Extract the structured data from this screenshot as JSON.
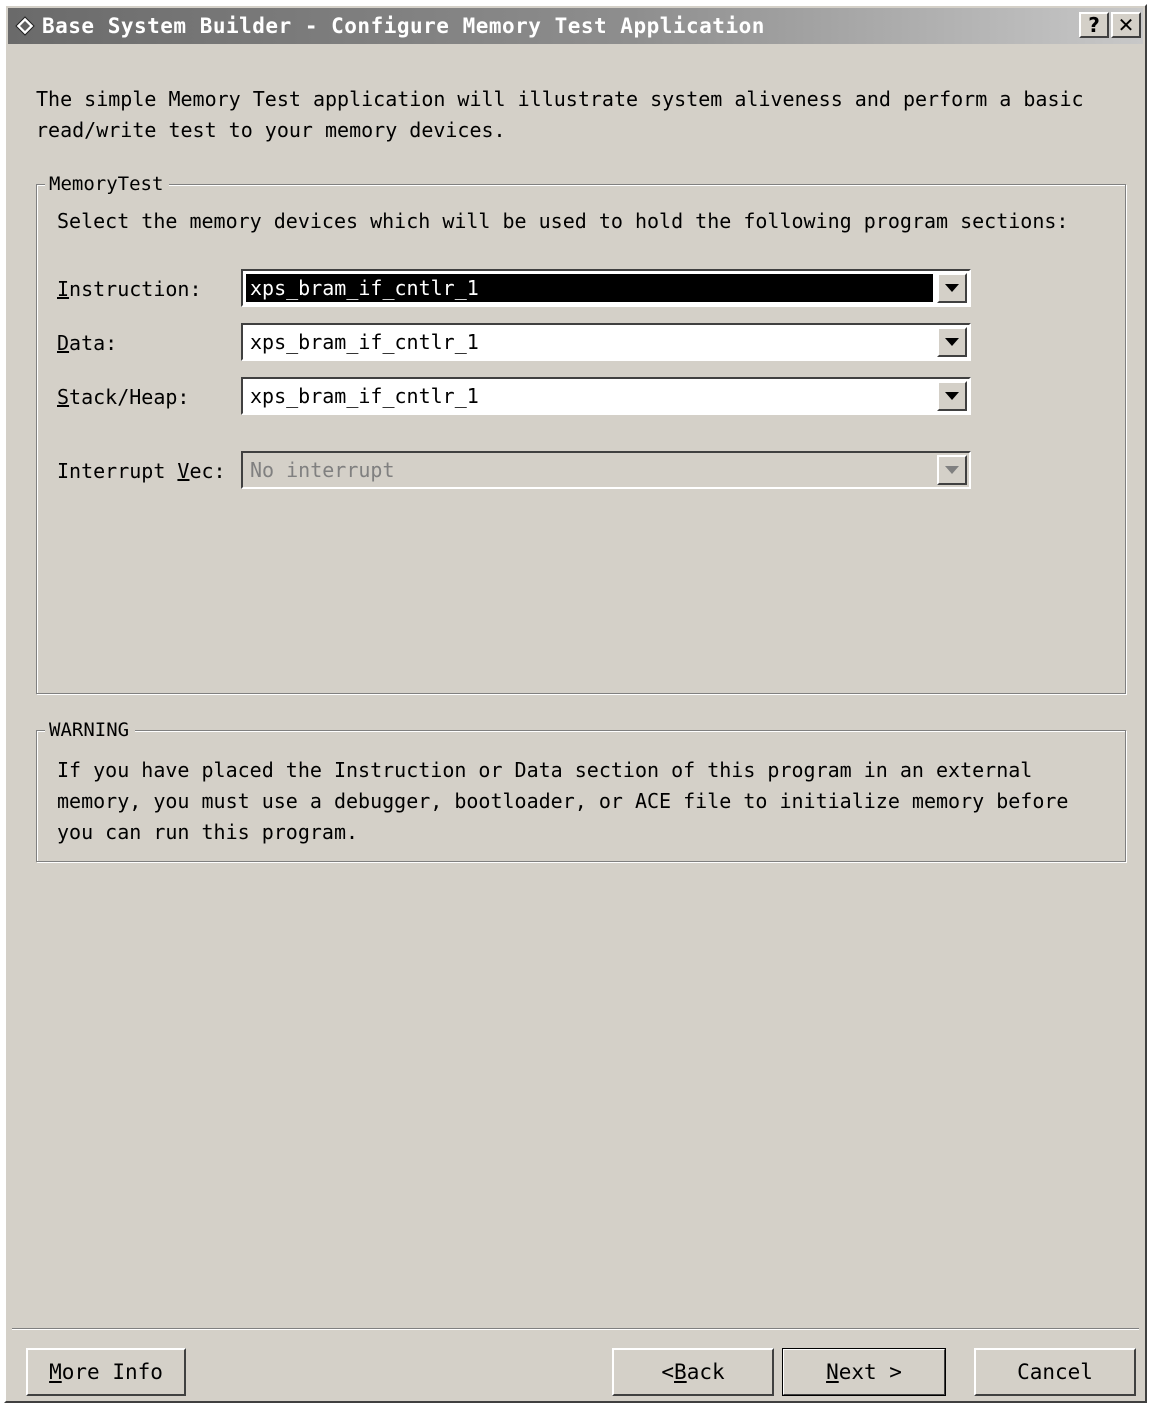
{
  "window": {
    "title": "Base System Builder - Configure Memory Test Application",
    "help_btn": "?",
    "close_btn": "✕"
  },
  "intro": {
    "line1": "The simple Memory Test application will illustrate system aliveness and perform a basic",
    "line2": "read/write test to your memory devices."
  },
  "memory_group": {
    "legend": "MemoryTest",
    "instructions": "Select the memory devices which will be used to hold the following program sections:",
    "rows": [
      {
        "mnemonic": "I",
        "label_rest": "nstruction:",
        "value": "xps_bram_if_cntlr_1",
        "disabled": false,
        "selected": true
      },
      {
        "mnemonic": "D",
        "label_rest": "ata:",
        "value": "xps_bram_if_cntlr_1",
        "disabled": false,
        "selected": false
      },
      {
        "mnemonic": "S",
        "label_rest": "tack/Heap:",
        "value": "xps_bram_if_cntlr_1",
        "disabled": false,
        "selected": false
      },
      {
        "label_prefix": "Interrupt ",
        "mnemonic": "V",
        "label_rest": "ec:",
        "value": "No interrupt",
        "disabled": true,
        "selected": false
      }
    ]
  },
  "warning_group": {
    "legend": "WARNING",
    "line1": "If you have placed the Instruction or Data section of this program in an external",
    "line2": "memory, you must use a debugger, bootloader, or ACE file to initialize memory before",
    "line3": "you can run this program."
  },
  "buttons": {
    "more_info": {
      "mnemonic": "M",
      "rest": "ore Info"
    },
    "back": {
      "prefix": "< ",
      "mnemonic": "B",
      "rest": "ack"
    },
    "next": {
      "mnemonic": "N",
      "rest": "ext >"
    },
    "cancel": {
      "label": "Cancel"
    }
  }
}
